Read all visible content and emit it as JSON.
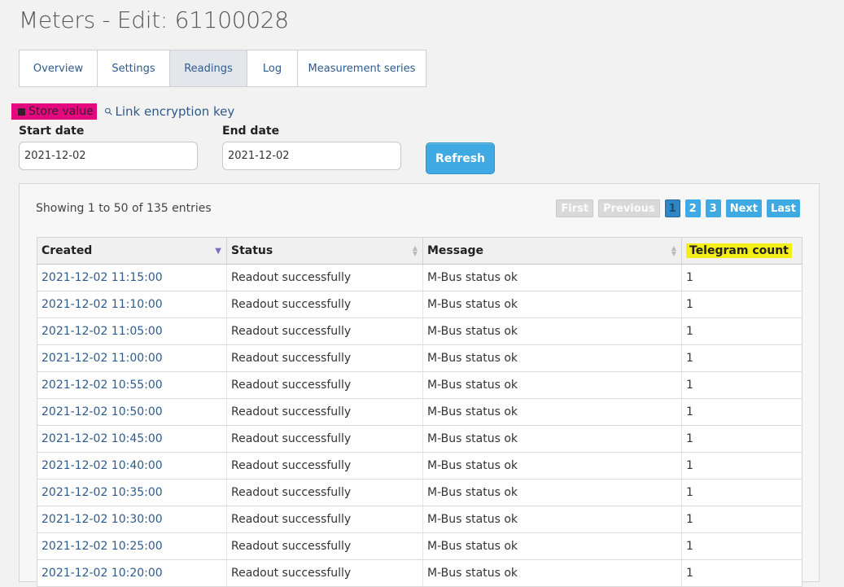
{
  "page": {
    "title": "Meters - Edit: 61100028"
  },
  "tabs": [
    {
      "label": "Overview",
      "active": false
    },
    {
      "label": "Settings",
      "active": false
    },
    {
      "label": "Readings",
      "active": true
    },
    {
      "label": "Log",
      "active": false
    },
    {
      "label": "Measurement series",
      "active": false
    }
  ],
  "actions": {
    "store_value": "Store value",
    "link_key": "Link encryption key"
  },
  "filters": {
    "start_label": "Start date",
    "start_value": "2021-12-02",
    "end_label": "End date",
    "end_value": "2021-12-02",
    "refresh_label": "Refresh"
  },
  "table_info": "Showing 1 to 50 of 135 entries",
  "pager": {
    "first": "First",
    "previous": "Previous",
    "pages": [
      "1",
      "2",
      "3"
    ],
    "current": "1",
    "next": "Next",
    "last": "Last"
  },
  "columns": {
    "created": "Created",
    "status": "Status",
    "message": "Message",
    "count": "Telegram count"
  },
  "rows": [
    {
      "created": "2021-12-02 11:15:00",
      "status": "Readout successfully",
      "message": "M-Bus status ok",
      "count": "1"
    },
    {
      "created": "2021-12-02 11:10:00",
      "status": "Readout successfully",
      "message": "M-Bus status ok",
      "count": "1"
    },
    {
      "created": "2021-12-02 11:05:00",
      "status": "Readout successfully",
      "message": "M-Bus status ok",
      "count": "1"
    },
    {
      "created": "2021-12-02 11:00:00",
      "status": "Readout successfully",
      "message": "M-Bus status ok",
      "count": "1"
    },
    {
      "created": "2021-12-02 10:55:00",
      "status": "Readout successfully",
      "message": "M-Bus status ok",
      "count": "1"
    },
    {
      "created": "2021-12-02 10:50:00",
      "status": "Readout successfully",
      "message": "M-Bus status ok",
      "count": "1"
    },
    {
      "created": "2021-12-02 10:45:00",
      "status": "Readout successfully",
      "message": "M-Bus status ok",
      "count": "1"
    },
    {
      "created": "2021-12-02 10:40:00",
      "status": "Readout successfully",
      "message": "M-Bus status ok",
      "count": "1"
    },
    {
      "created": "2021-12-02 10:35:00",
      "status": "Readout successfully",
      "message": "M-Bus status ok",
      "count": "1"
    },
    {
      "created": "2021-12-02 10:30:00",
      "status": "Readout successfully",
      "message": "M-Bus status ok",
      "count": "1"
    },
    {
      "created": "2021-12-02 10:25:00",
      "status": "Readout successfully",
      "message": "M-Bus status ok",
      "count": "1"
    },
    {
      "created": "2021-12-02 10:20:00",
      "status": "Readout successfully",
      "message": "M-Bus status ok",
      "count": "1"
    }
  ],
  "colors": {
    "store_highlight": "#e5097f",
    "column_highlight": "#f3ed18",
    "accent": "#3ea9e3",
    "link": "#2e5a8c"
  }
}
